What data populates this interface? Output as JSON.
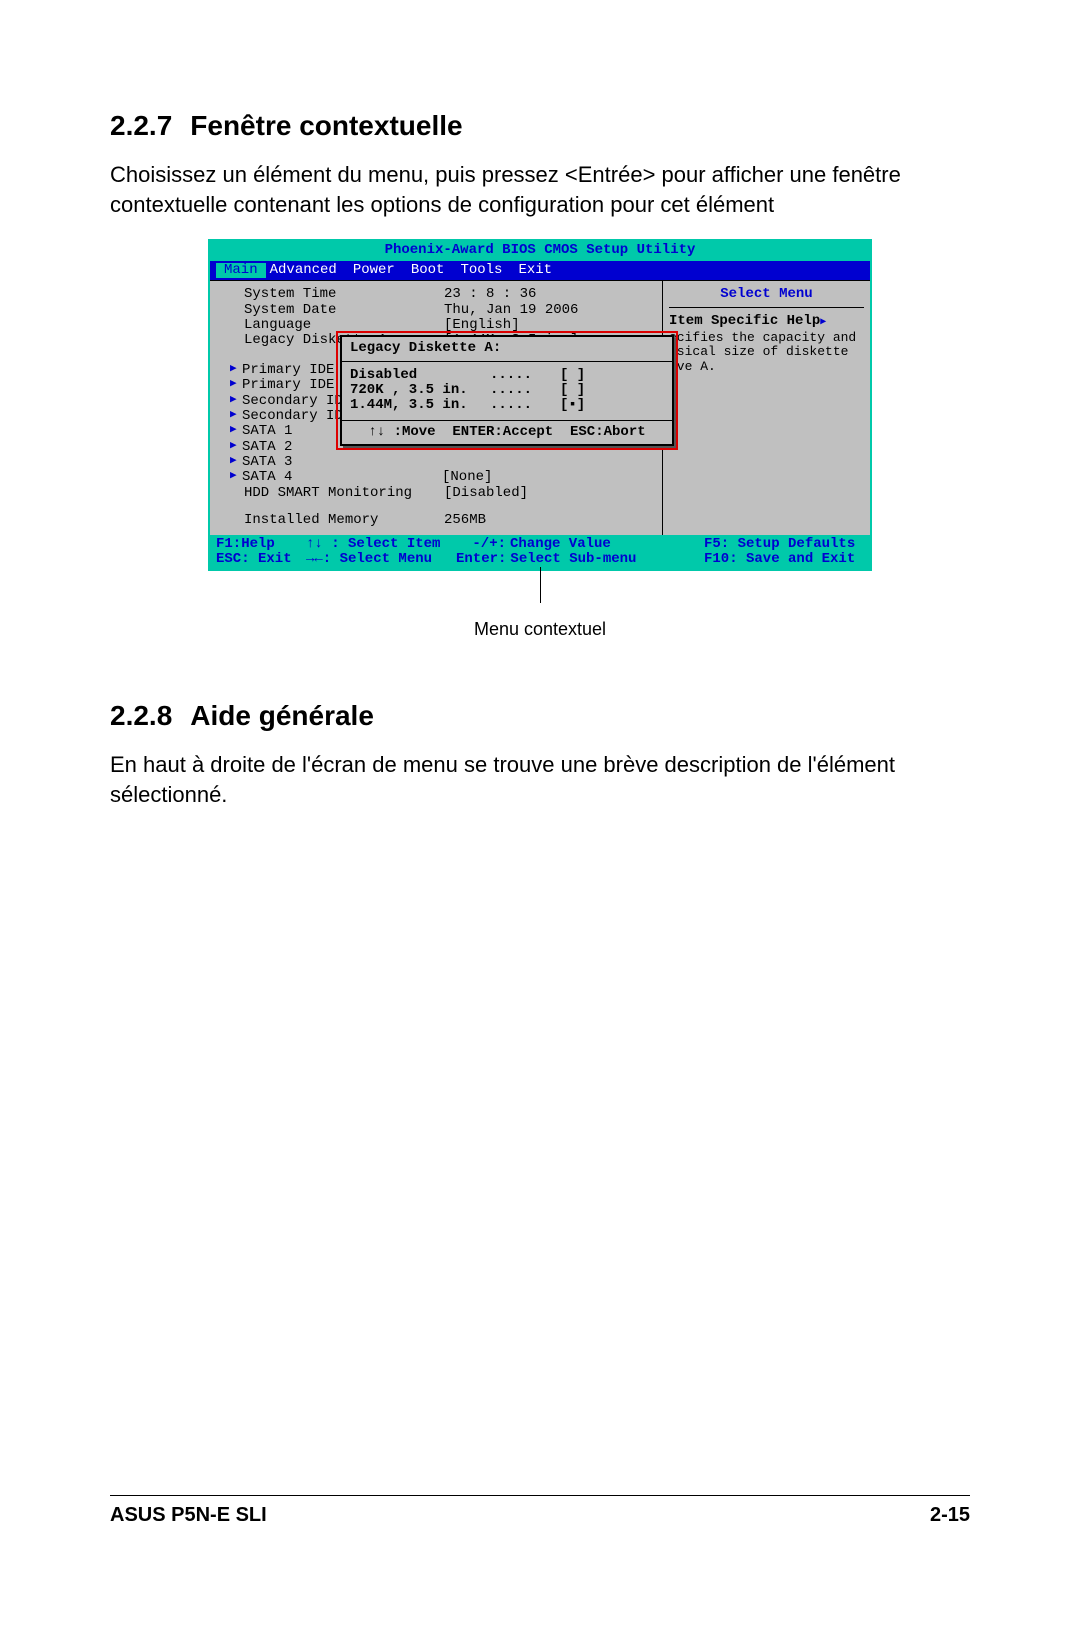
{
  "section1": {
    "num": "2.2.7",
    "title": "Fenêtre contextuelle"
  },
  "para1": "Choisissez un élément du menu, puis pressez <Entrée> pour afficher une fenêtre contextuelle contenant les options de configuration pour cet élément",
  "bios": {
    "title": "Phoenix-Award BIOS CMOS Setup Utility",
    "menu": [
      "Main",
      "Advanced",
      "Power",
      "Boot",
      "Tools",
      "Exit"
    ],
    "rows": [
      {
        "lbl": "System Time",
        "val": "23 : 8 : 36"
      },
      {
        "lbl": "System Date",
        "val": "Thu, Jan 19 2006"
      },
      {
        "lbl": "Language",
        "val": "[English]"
      },
      {
        "lbl": "Legacy Diskette A:",
        "val": "[1.44M, 3.5 in.]"
      }
    ],
    "subrows": [
      "Primary IDE Mas",
      "Primary IDE Sla",
      "Secondary IDE M",
      "Secondary IDE S",
      "SATA 1",
      "SATA 2",
      "SATA 3",
      "SATA 4"
    ],
    "nonevals": "[None]",
    "hdd": {
      "lbl": "HDD SMART Monitoring",
      "val": "[Disabled]"
    },
    "mem": {
      "lbl": "Installed Memory",
      "val": "256MB"
    },
    "helpTitle": "Select Menu",
    "helpSub": "Item Specific Help",
    "helpText": "ecifies the capacity and ysical size of diskette ive A.",
    "foot": {
      "l1a": "F1:Help",
      "l1b": "↑↓ : Select Item",
      "l1c": "-/+:",
      "l1d": "Change Value",
      "l1e": "F5: Setup Defaults",
      "l2a": "ESC: Exit",
      "l2b": "→←: Select Menu",
      "l2c": "Enter:",
      "l2d": "Select Sub-menu",
      "l2e": "F10: Save and Exit"
    }
  },
  "popup": {
    "title": "Legacy Diskette A:",
    "opts": [
      {
        "t": "Disabled",
        "sel": false
      },
      {
        "t": "720K , 3.5 in.",
        "sel": false
      },
      {
        "t": "1.44M, 3.5 in.",
        "sel": true
      }
    ],
    "foot": "↑↓ :Move  ENTER:Accept  ESC:Abort"
  },
  "callout": "Menu contextuel",
  "section2": {
    "num": "2.2.8",
    "title": "Aide générale"
  },
  "para2": "En haut à droite de l'écran de menu se trouve une brève description de l'élément sélectionné.",
  "footer": {
    "left": "ASUS P5N-E SLI",
    "right": "2-15"
  }
}
